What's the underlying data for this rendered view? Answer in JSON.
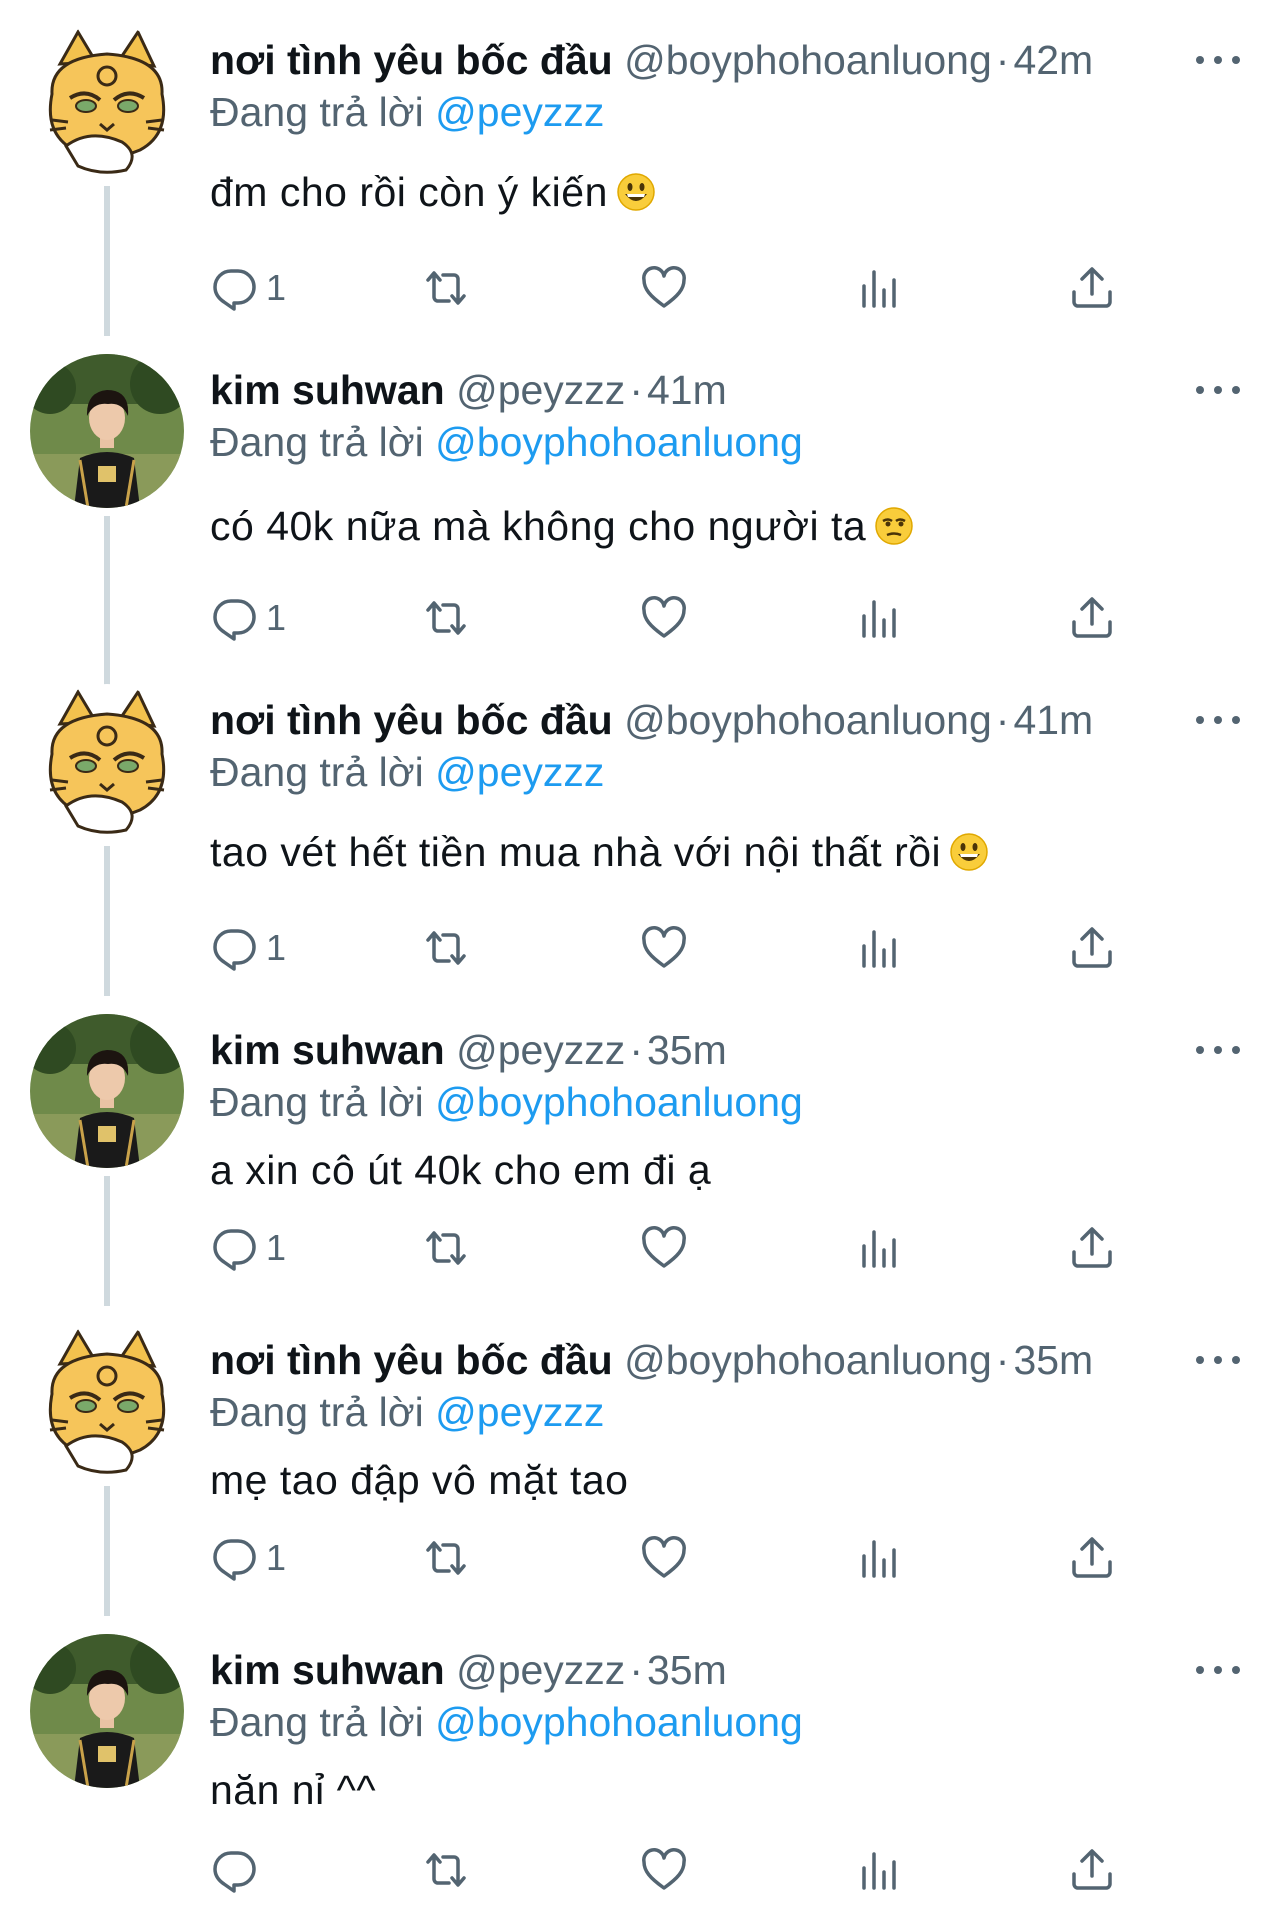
{
  "reply_prefix": "Đang trả lời",
  "tweets": [
    {
      "name": "nơi tình yêu bốc đầu",
      "handle": "@boyphohoanluong",
      "separator": "·",
      "time": "42m",
      "reply_to": "@peyzzz",
      "text": "đm cho rồi còn ý kiến",
      "emoji": "grinning-face-emoji",
      "reply_count": "1",
      "avatar": "tiger-cartoon-avatar"
    },
    {
      "name": "kim suhwan",
      "handle": "@peyzzz",
      "separator": "·",
      "time": "41m",
      "reply_to": "@boyphohoanluong",
      "text": "có 40k nữa mà không cho người ta",
      "emoji": "unamused-face-emoji",
      "reply_count": "1",
      "avatar": "person-photo-avatar"
    },
    {
      "name": "nơi tình yêu bốc đầu",
      "handle": "@boyphohoanluong",
      "separator": "·",
      "time": "41m",
      "reply_to": "@peyzzz",
      "text": "tao vét hết tiền mua nhà với nội thất rồi",
      "emoji": "grinning-face-emoji",
      "reply_count": "1",
      "avatar": "tiger-cartoon-avatar"
    },
    {
      "name": "kim suhwan",
      "handle": "@peyzzz",
      "separator": "·",
      "time": "35m",
      "reply_to": "@boyphohoanluong",
      "text": "a xin cô út 40k cho em đi ạ",
      "reply_count": "1",
      "avatar": "person-photo-avatar"
    },
    {
      "name": "nơi tình yêu bốc đầu",
      "handle": "@boyphohoanluong",
      "separator": "·",
      "time": "35m",
      "reply_to": "@peyzzz",
      "text": "mẹ tao đập vô mặt tao",
      "reply_count": "1",
      "avatar": "tiger-cartoon-avatar"
    },
    {
      "name": "kim suhwan",
      "handle": "@peyzzz",
      "separator": "·",
      "time": "35m",
      "reply_to": "@boyphohoanluong",
      "text": "năn nỉ ^^",
      "reply_count": "",
      "avatar": "person-photo-avatar"
    }
  ],
  "icons": [
    "reply-icon",
    "retweet-icon",
    "like-icon",
    "views-icon",
    "share-icon",
    "more-icon"
  ],
  "colors": {
    "link": "#1d9bf0",
    "secondary": "#536471",
    "text": "#0f1419",
    "thread_line": "#cfd9de"
  }
}
